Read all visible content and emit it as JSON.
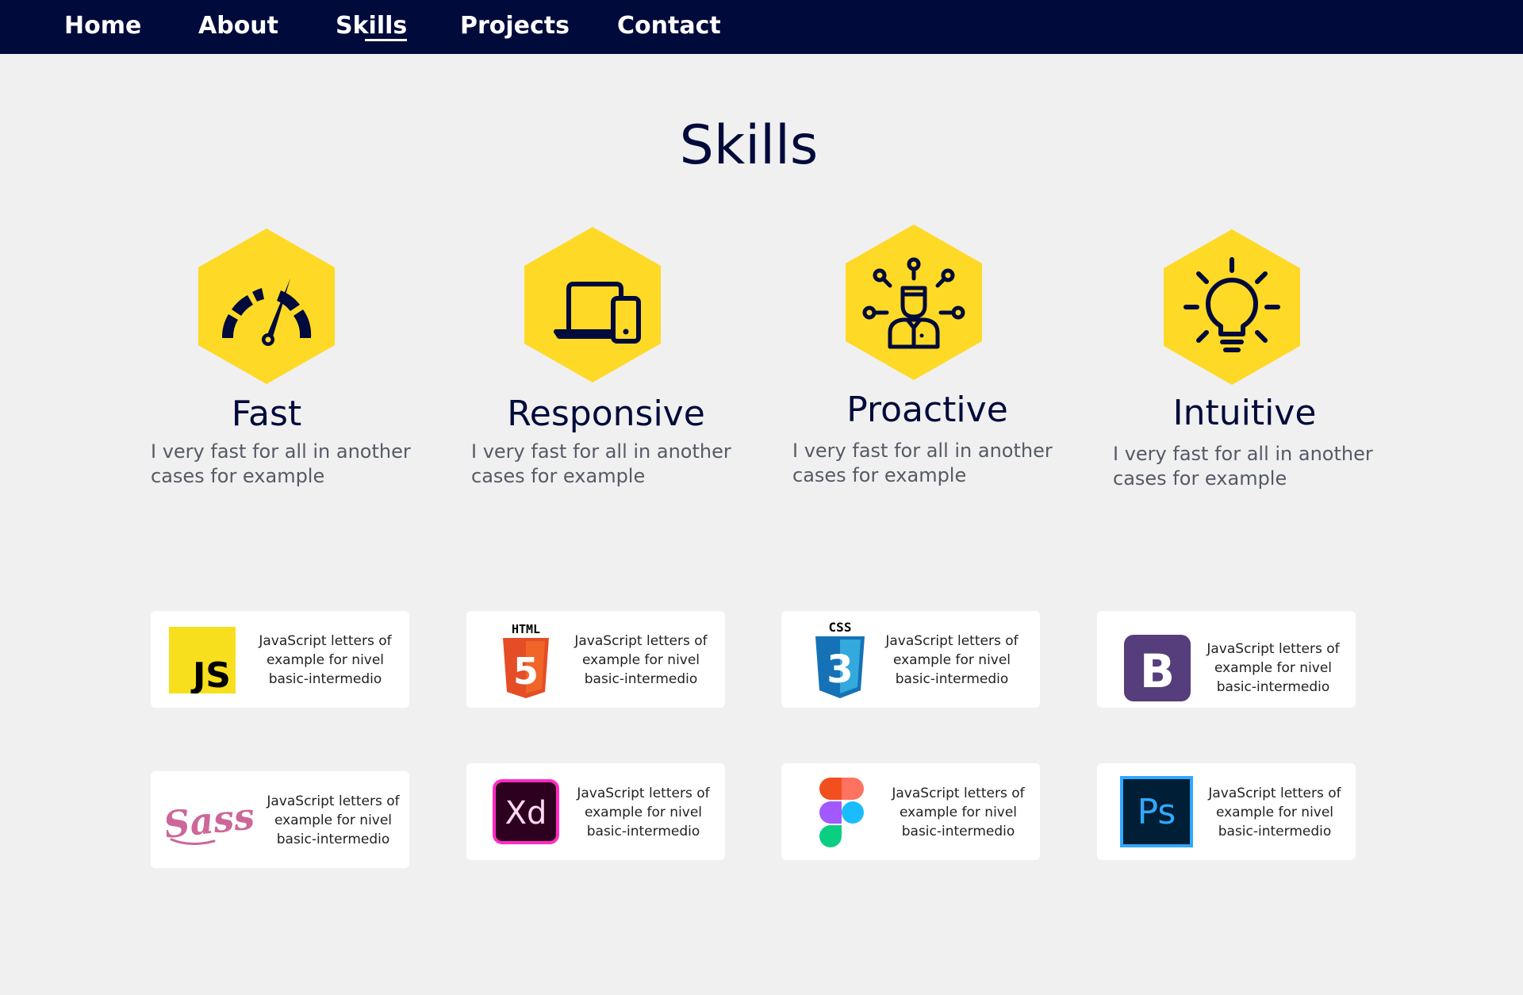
{
  "nav": {
    "links": [
      {
        "label": "Home"
      },
      {
        "label": "About"
      },
      {
        "label": "Skills"
      },
      {
        "label": "Projects"
      },
      {
        "label": "Contact"
      }
    ],
    "active": "Skills"
  },
  "section": {
    "title": "Skills"
  },
  "skills": [
    {
      "title": "Fast",
      "description": "I very fast for all in another cases for example",
      "icon": "speedometer-icon"
    },
    {
      "title": "Responsive",
      "description": "I very fast for all in another cases for example",
      "icon": "devices-icon"
    },
    {
      "title": "Proactive",
      "description": "I very fast for all in another cases for example",
      "icon": "person-network-icon"
    },
    {
      "title": "Intuitive",
      "description": "I very fast for all in another cases for example",
      "icon": "lightbulb-icon"
    }
  ],
  "tech": {
    "javascript": {
      "text": "JavaScript letters of example for nivel basic-intermedio",
      "logo_text": "JS"
    },
    "html": {
      "text": "JavaScript letters of example for nivel basic-intermedio",
      "logo_text": "HTML",
      "logo_digit": "5"
    },
    "css": {
      "text": "JavaScript letters of example for nivel basic-intermedio",
      "logo_text": "CSS",
      "logo_digit": "3"
    },
    "bootstrap": {
      "text": "JavaScript letters of example for nivel basic-intermedio",
      "logo_text": "B"
    },
    "sass": {
      "text": "JavaScript letters of example for nivel basic-intermedio",
      "logo_text": "Sass"
    },
    "xd": {
      "text": "JavaScript letters of example for nivel basic-intermedio",
      "logo_text": "Xd"
    },
    "figma": {
      "text": "JavaScript letters of example for nivel basic-intermedio"
    },
    "photoshop": {
      "text": "JavaScript letters of example for nivel basic-intermedio",
      "logo_text": "Ps"
    }
  },
  "colors": {
    "navy": "#000a3b",
    "accent_yellow": "#fed926",
    "background": "#f0f0f0",
    "card": "#ffffff"
  }
}
